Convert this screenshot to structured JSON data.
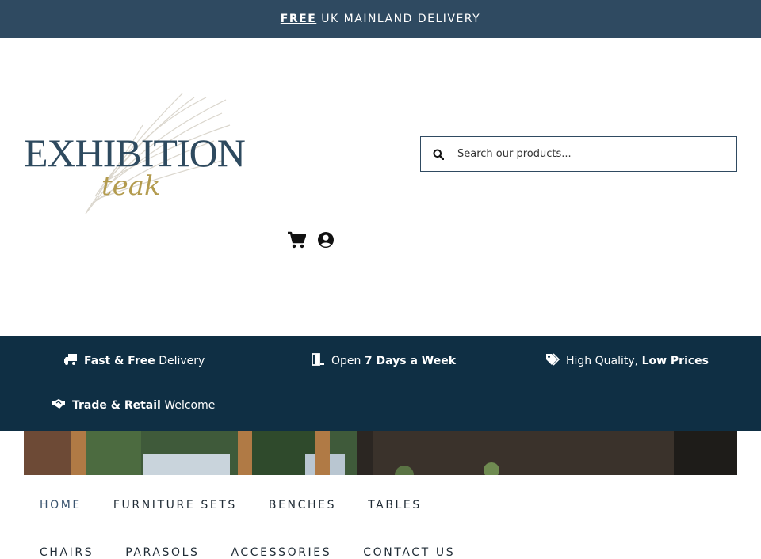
{
  "topbar": {
    "free": "FREE",
    "text": "UK MAINLAND DELIVERY"
  },
  "logo": {
    "title": "EXHIBITION",
    "subtitle": "teak"
  },
  "search": {
    "placeholder": "Search our products..."
  },
  "header_icons": {
    "cart": "shopping-cart-icon",
    "account": "user-circle-icon"
  },
  "nav": {
    "row1": [
      "HOME",
      "FURNITURE SETS",
      "BENCHES",
      "TABLES"
    ],
    "row2": [
      "CHAIRS",
      "PARASOLS",
      "ACCESSORIES",
      "CONTACT US"
    ]
  },
  "features": {
    "delivery": {
      "bold": "Fast & Free",
      "rest": "Delivery"
    },
    "open": {
      "pre": "Open",
      "bold": "7 Days a Week"
    },
    "quality": {
      "pre": "High Quality,",
      "bold": "Low Prices"
    },
    "trade": {
      "bold": "Trade & Retail",
      "rest": "Welcome"
    }
  },
  "colors": {
    "topbar": "#2f4a61",
    "features_bar": "#0f2f44",
    "logo_gold": "#b39b4e"
  }
}
